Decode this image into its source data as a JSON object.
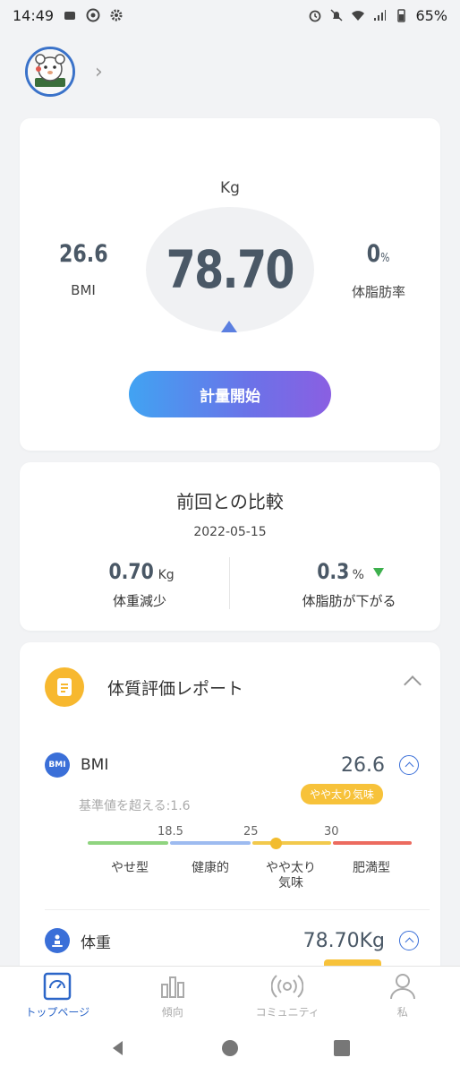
{
  "status_bar": {
    "time": "14:49",
    "battery": "65%"
  },
  "main_card": {
    "unit": "Kg",
    "weight": "78.70",
    "bmi_value": "26.6",
    "bmi_label": "BMI",
    "fat_value": "0",
    "fat_unit": "%",
    "fat_label": "体脂肪率",
    "start_button": "計量開始"
  },
  "compare_card": {
    "title": "前回との比較",
    "date": "2022-05-15",
    "weight_change": "0.70",
    "weight_unit": "Kg",
    "weight_desc": "体重減少",
    "fat_change": "0.3",
    "fat_unit": "%",
    "fat_desc": "体脂肪が下がる"
  },
  "report": {
    "title": "体質評価レポート",
    "bmi": {
      "icon_text": "BMI",
      "name": "BMI",
      "value": "26.6",
      "badge": "やや太り気味",
      "exceed_text": "基準値を超える:1.6",
      "thresholds": [
        "18.5",
        "25",
        "30"
      ],
      "categories": [
        "やせ型",
        "健康的",
        "やや太り\n気味",
        "肥満型"
      ],
      "colors": [
        "#8fd47f",
        "#9dbbf0",
        "#f2c94c",
        "#ec6b5f"
      ]
    },
    "weight": {
      "name": "体重",
      "value": "78.70Kg"
    }
  },
  "tabs": [
    {
      "label": "トップページ",
      "icon": "scale-icon",
      "active": true
    },
    {
      "label": "傾向",
      "icon": "bar-chart-icon",
      "active": false
    },
    {
      "label": "コミュニティ",
      "icon": "broadcast-icon",
      "active": false
    },
    {
      "label": "私",
      "icon": "person-icon",
      "active": false
    }
  ]
}
